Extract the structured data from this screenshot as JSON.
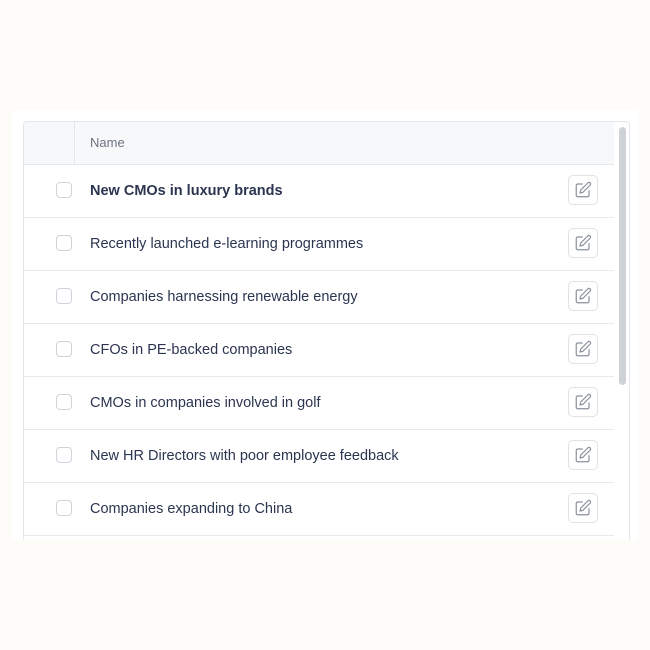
{
  "table": {
    "header": {
      "name_label": "Name"
    },
    "rows": [
      {
        "label": "New CMOs in luxury brands",
        "bold": true,
        "checked": false,
        "edit_icon": "edit-icon"
      },
      {
        "label": "Recently launched e-learning programmes",
        "bold": false,
        "checked": false,
        "edit_icon": "edit-icon"
      },
      {
        "label": "Companies harnessing renewable energy",
        "bold": false,
        "checked": false,
        "edit_icon": "edit-icon"
      },
      {
        "label": "CFOs in PE-backed companies",
        "bold": false,
        "checked": false,
        "edit_icon": "edit-icon"
      },
      {
        "label": "CMOs in companies involved in golf",
        "bold": false,
        "checked": false,
        "edit_icon": "edit-icon"
      },
      {
        "label": "New HR Directors with poor employee feedback",
        "bold": false,
        "checked": false,
        "edit_icon": "edit-icon"
      },
      {
        "label": "Companies expanding to China",
        "bold": false,
        "checked": false,
        "edit_icon": "edit-icon"
      }
    ]
  },
  "colors": {
    "text": "#2b3550",
    "header_text": "#6b7380",
    "border": "#e3e6ea",
    "icon": "#8a919c"
  }
}
